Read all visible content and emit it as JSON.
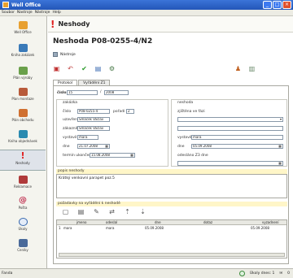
{
  "window": {
    "title": "Well Office"
  },
  "menu": [
    "Soubor",
    "Nastroje",
    "Nástroje",
    "Help"
  ],
  "sidebar": {
    "items": [
      {
        "label": "Well Office",
        "icon": "house-icon",
        "color": "#e8a030"
      },
      {
        "label": "Kniha zakázek",
        "icon": "book-icon",
        "color": "#3a7ab8"
      },
      {
        "label": "Plán výroby",
        "icon": "network-icon",
        "color": "#6aa04a"
      },
      {
        "label": "Plan montaze",
        "icon": "tools-icon",
        "color": "#b85a3a"
      },
      {
        "label": "Plán obchodu",
        "icon": "people-icon",
        "color": "#d07030"
      },
      {
        "label": "Kniha objednávek",
        "icon": "order-book-icon",
        "color": "#2a8ab0"
      },
      {
        "label": "Neshody",
        "icon": "exclamation-icon",
        "color": "#e02020"
      },
      {
        "label": "Reklamace",
        "icon": "car-icon",
        "color": "#b03a3a"
      },
      {
        "label": "Pošta",
        "icon": "mail-at-icon",
        "color": "#c03050"
      },
      {
        "label": "Úkoly",
        "icon": "clock-icon",
        "color": "#3a6ab0"
      },
      {
        "label": "Ceníky",
        "icon": "price-list-icon",
        "color": "#4a6a9a"
      }
    ]
  },
  "header": {
    "title": "Neshody"
  },
  "document": {
    "title": "Neshoda P08-0255-4/N2",
    "toolbar_label": "Nástroje"
  },
  "tabs": [
    "Protokol",
    "Vyřádění Z1"
  ],
  "form": {
    "cislo_label": "číslo",
    "cislo_value": "15",
    "rok_value": "2008",
    "zakazka_label": "zakázka",
    "neshoda_label": "neshoda",
    "cislo2_label": "číslo",
    "cislo2_value": "P08-0255-4",
    "poradi_label": "pořadí",
    "poradi_value": "2",
    "zjistena_label": "zjištěna ve fázi",
    "uzavreni_label": "uzavření",
    "uzavreni_value": "Šmáček Václav",
    "zakaznik_label": "zákazník",
    "zakaznik_value": "Šmáček Václav",
    "vystavil_label": "vystavil",
    "vystavil_value": "mara",
    "vystavil2_label": "vystavil",
    "vystavil2_value": "mara",
    "dne_label": "dne",
    "dne_value": "21.07.2008",
    "dne2_label": "dne",
    "dne2_value": "05.09.2008",
    "odeslano_label": "odesláno Z3 dne",
    "termin_label": "termín ukončení",
    "termin_value": "15.08.2008"
  },
  "popis": {
    "label": "popis neshody",
    "text": "Krátký venkovní parapet poz.5"
  },
  "pozadavky": {
    "label": "požadavky na vyřádění k neshodě",
    "columns": [
      "jmeno",
      "odeslal",
      "dne",
      "dotaz",
      "vyzadnení"
    ],
    "rows": [
      {
        "n": "1",
        "jmeno": "mara",
        "odeslal": "mara",
        "dne": "05.09.2008",
        "dotaz": "",
        "vyz": "05.09.2008"
      }
    ]
  },
  "status": {
    "left": "Fanda",
    "tasks": "Úkoly dnes: 1",
    "mail": "0"
  }
}
